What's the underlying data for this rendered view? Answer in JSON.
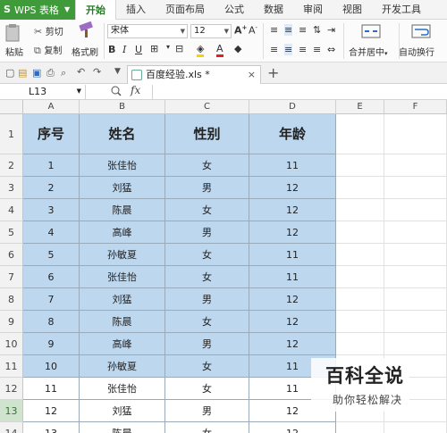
{
  "app": {
    "name": "WPS 表格"
  },
  "menu": [
    "开始",
    "插入",
    "页面布局",
    "公式",
    "数据",
    "审阅",
    "视图",
    "开发工具"
  ],
  "ribbon": {
    "paste": "粘贴",
    "cut": "剪切",
    "copy": "复制",
    "format_painter": "格式刷",
    "font": "宋体",
    "font_size": "12",
    "merge_center": "合并居中",
    "wrap_text": "自动换行"
  },
  "doc_tab": {
    "name": "百度经验.xls *"
  },
  "formula_bar": {
    "cell_ref": "L13",
    "fx": "fx"
  },
  "columns": [
    "A",
    "B",
    "C",
    "D",
    "E",
    "F"
  ],
  "headers": [
    "序号",
    "姓名",
    "性别",
    "年龄"
  ],
  "rows": [
    [
      "1",
      "张佳怡",
      "女",
      "11"
    ],
    [
      "2",
      "刘猛",
      "男",
      "12"
    ],
    [
      "3",
      "陈晨",
      "女",
      "12"
    ],
    [
      "4",
      "高峰",
      "男",
      "12"
    ],
    [
      "5",
      "孙敏夏",
      "女",
      "11"
    ],
    [
      "6",
      "张佳怡",
      "女",
      "11"
    ],
    [
      "7",
      "刘猛",
      "男",
      "12"
    ],
    [
      "8",
      "陈晨",
      "女",
      "12"
    ],
    [
      "9",
      "高峰",
      "男",
      "12"
    ],
    [
      "10",
      "孙敏夏",
      "女",
      "11"
    ],
    [
      "11",
      "张佳怡",
      "女",
      "11"
    ],
    [
      "12",
      "刘猛",
      "男",
      "12"
    ],
    [
      "13",
      "陈晨",
      "女",
      "12"
    ]
  ],
  "row_numbers": [
    "1",
    "2",
    "3",
    "4",
    "5",
    "6",
    "7",
    "8",
    "9",
    "10",
    "11",
    "12",
    "13",
    "14"
  ],
  "selected_row": "13",
  "watermark": {
    "title": "百科全说",
    "subtitle": "助你轻松解决"
  },
  "colors": {
    "accent": "#3f9b3a",
    "table_fill": "#bdd7ee"
  }
}
